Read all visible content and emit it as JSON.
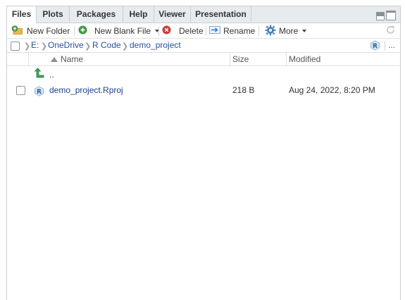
{
  "tabs": [
    {
      "label": "Files",
      "active": true
    },
    {
      "label": "Plots",
      "active": false
    },
    {
      "label": "Packages",
      "active": false
    },
    {
      "label": "Help",
      "active": false
    },
    {
      "label": "Viewer",
      "active": false
    },
    {
      "label": "Presentation",
      "active": false
    }
  ],
  "toolbar": {
    "new_folder": "New Folder",
    "new_blank_file": "New Blank File",
    "delete": "Delete",
    "rename": "Rename",
    "more": "More"
  },
  "breadcrumb": {
    "items": [
      "E:",
      "OneDrive",
      "R Code",
      "demo_project"
    ],
    "more_label": "..."
  },
  "columns": {
    "name": "Name",
    "size": "Size",
    "modified": "Modified"
  },
  "files": {
    "parent_label": "..",
    "rows": [
      {
        "name": "demo_project.Rproj",
        "size": "218 B",
        "modified": "Aug 24, 2022, 8:20 PM"
      }
    ]
  },
  "colors": {
    "link": "#1a3e8f",
    "tab_bar": "#e8ebee",
    "border": "#c9ced4"
  }
}
